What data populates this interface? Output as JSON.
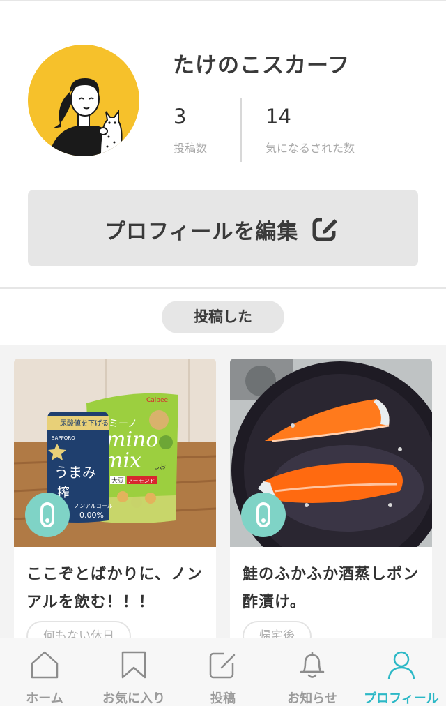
{
  "profile": {
    "username": "たけのこスカーフ",
    "posts_count": "3",
    "posts_label": "投稿数",
    "liked_count": "14",
    "liked_label": "気になるされた数"
  },
  "edit_profile_label": "プロフィールを編集",
  "posts_tab_label": "投稿した",
  "posts": [
    {
      "title": "ここぞとばかりに、ノンアルを飲む！！！",
      "tag": "何もない休日"
    },
    {
      "title": "鮭のふかふか酒蒸しポン酢漬け。",
      "tag": "帰宅後"
    }
  ],
  "product_text": {
    "can_lines": [
      "尿酸値を下げる",
      "SAPPORO",
      "うまみ",
      "搾",
      "ノンアルコール",
      "0.00%"
    ],
    "bag_brand": "Calbee",
    "bag_top": "ミーノ",
    "bag_name_1": "mino",
    "bag_name_2": "mix",
    "bag_label_1": "大豆",
    "bag_label_2": "アーモンド",
    "bag_flavor": "しお"
  },
  "tabs": [
    {
      "label": "ホーム",
      "icon": "home-icon"
    },
    {
      "label": "お気に入り",
      "icon": "bookmark-icon"
    },
    {
      "label": "投稿",
      "icon": "compose-icon"
    },
    {
      "label": "お知らせ",
      "icon": "bell-icon"
    },
    {
      "label": "プロフィール",
      "icon": "user-icon",
      "active": true
    }
  ],
  "colors": {
    "accent": "#2cb8c6",
    "avatar_bg": "#f6c12b",
    "badge": "#7fd3c6",
    "button_bg": "#e6e6e6"
  }
}
